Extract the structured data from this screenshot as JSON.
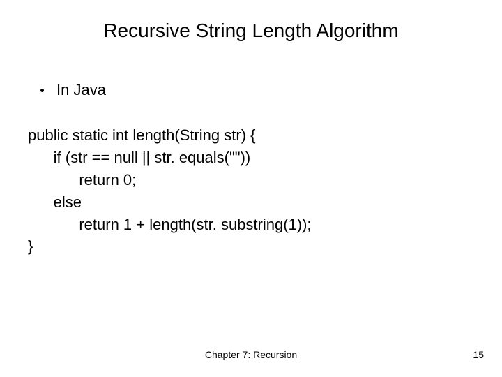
{
  "title": "Recursive String Length Algorithm",
  "bullet": "In Java",
  "code": {
    "l1": "public static int length(String str) {",
    "l2": "      if (str == null || str. equals(\"\"))",
    "l3": "            return 0;",
    "l4": "      else",
    "l5": "            return 1 + length(str. substring(1));",
    "l6": "}"
  },
  "footer": {
    "chapter": "Chapter 7: Recursion",
    "page": "15"
  }
}
